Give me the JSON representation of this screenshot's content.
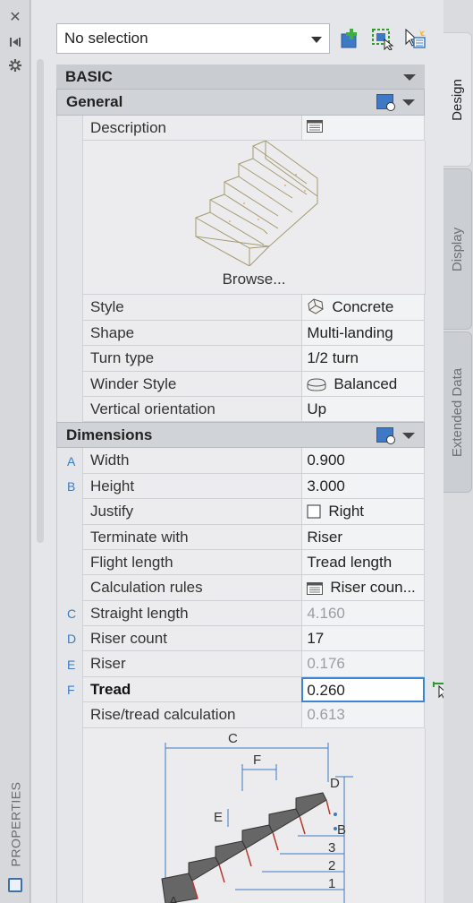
{
  "palette_title": "PROPERTIES",
  "selection": {
    "value": "No selection"
  },
  "sections": {
    "basic": "BASIC",
    "general": "General",
    "dimensions": "Dimensions"
  },
  "general": {
    "description_label": "Description",
    "browse_label": "Browse...",
    "rows": [
      {
        "name": "Style",
        "value": "Concrete",
        "icon": "concrete-style-icon"
      },
      {
        "name": "Shape",
        "value": "Multi-landing"
      },
      {
        "name": "Turn type",
        "value": "1/2 turn"
      },
      {
        "name": "Winder Style",
        "value": "Balanced",
        "icon": "winder-style-icon"
      },
      {
        "name": "Vertical orientation",
        "value": "Up"
      }
    ]
  },
  "dimensions": {
    "rows": [
      {
        "letter": "A",
        "name": "Width",
        "value": "0.900"
      },
      {
        "letter": "B",
        "name": "Height",
        "value": "3.000"
      },
      {
        "letter": "",
        "name": "Justify",
        "value": "Right",
        "icon": "justify-box-icon"
      },
      {
        "letter": "",
        "name": "Terminate with",
        "value": "Riser"
      },
      {
        "letter": "",
        "name": "Flight length",
        "value": "Tread length"
      },
      {
        "letter": "",
        "name": "Calculation rules",
        "value": "Riser coun...",
        "icon": "calculation-rules-icon"
      },
      {
        "letter": "C",
        "name": "Straight length",
        "value": "4.160",
        "readonly": true
      },
      {
        "letter": "D",
        "name": "Riser count",
        "value": "17"
      },
      {
        "letter": "E",
        "name": "Riser",
        "value": "0.176",
        "readonly": true
      },
      {
        "letter": "F",
        "name": "Tread",
        "value": "0.260",
        "editing": true
      },
      {
        "letter": "",
        "name": "Rise/tread calculation",
        "value": "0.613",
        "readonly": true
      }
    ]
  },
  "diagram_labels": {
    "c": "C",
    "f": "F",
    "e": "E",
    "d": "D",
    "b": "B",
    "a": "A",
    "n1": "1",
    "n2": "2",
    "n3": "3"
  },
  "tabs": [
    "Design",
    "Display",
    "Extended Data"
  ],
  "colors": {
    "accent": "#3a86d4",
    "letter": "#3c7cc2"
  }
}
